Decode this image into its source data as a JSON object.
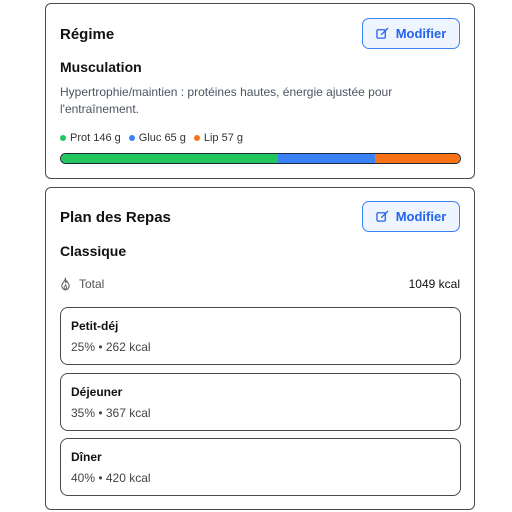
{
  "regime": {
    "title": "Régime",
    "modify_label": "Modifier",
    "name": "Musculation",
    "description": "Hypertrophie/maintien : protéines hautes, énergie ajustée pour l'entraînement.",
    "macros": [
      {
        "label": "Prot 146 g",
        "color": "#22c55e",
        "grams": 146
      },
      {
        "label": "Gluc 65 g",
        "color": "#3b82f6",
        "grams": 65
      },
      {
        "label": "Lip 57 g",
        "color": "#f97316",
        "grams": 57
      }
    ]
  },
  "meal_plan": {
    "title": "Plan des Repas",
    "modify_label": "Modifier",
    "name": "Classique",
    "total_icon": "flame-icon",
    "total_label": "Total",
    "total_value": "1049 kcal",
    "meals": [
      {
        "name": "Petit-déj",
        "info": "25% • 262 kcal"
      },
      {
        "name": "Déjeuner",
        "info": "35% • 367 kcal"
      },
      {
        "name": "Dîner",
        "info": "40% • 420 kcal"
      }
    ]
  },
  "icons": {
    "modify": "edit-icon"
  },
  "colors": {
    "accent": "#2563eb",
    "button_bg": "#eef5ff"
  }
}
